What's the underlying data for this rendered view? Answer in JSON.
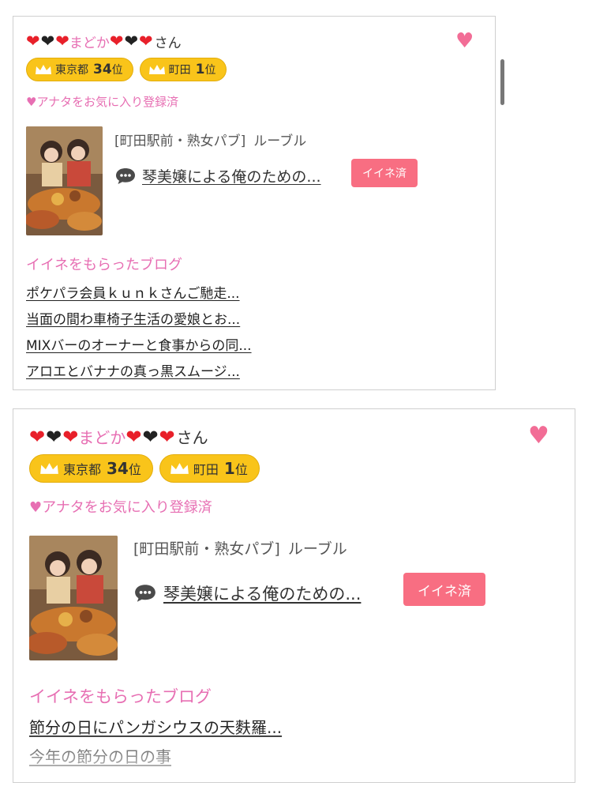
{
  "colors": {
    "accent_pink": "#e76fb3",
    "badge_gold": "#f9c41a",
    "like_button": "#f86e82",
    "favorite_heart": "#f26d96"
  },
  "cards": [
    {
      "name_hearts_before": [
        "red",
        "black",
        "red"
      ],
      "name": "まどか",
      "name_hearts_after": [
        "red",
        "black",
        "red"
      ],
      "suffix": "さん",
      "favorite_icon": "heart-icon",
      "rankings": [
        {
          "icon": "crown-icon",
          "area": "東京都",
          "rank": "34",
          "unit": "位"
        },
        {
          "icon": "crown-icon",
          "area": "町田",
          "rank": "1",
          "unit": "位"
        }
      ],
      "favorite_status": "♥アナタをお気に入り登録済",
      "shop": {
        "tag": "[町田駅前・熟女パブ]",
        "name": "ルーブル"
      },
      "post": {
        "icon": "speech-bubble-icon",
        "title": "琴美嬢による俺のための..."
      },
      "like_button": "イイネ済",
      "blogs_heading": "イイネをもらったブログ",
      "blogs": [
        "ポケパラ会員ｋｕｎｋさんご馳走...",
        "当面の間わ車椅子生活の愛娘とお...",
        "MIXバーのオーナーと食事からの同...",
        "アロエとバナナの真っ黒スムージ..."
      ]
    },
    {
      "name_hearts_before": [
        "red",
        "black",
        "red"
      ],
      "name": "まどか",
      "name_hearts_after": [
        "red",
        "black",
        "red"
      ],
      "suffix": "さん",
      "favorite_icon": "heart-icon",
      "rankings": [
        {
          "icon": "crown-icon",
          "area": "東京都",
          "rank": "34",
          "unit": "位"
        },
        {
          "icon": "crown-icon",
          "area": "町田",
          "rank": "1",
          "unit": "位"
        }
      ],
      "favorite_status": "♥アナタをお気に入り登録済",
      "shop": {
        "tag": "[町田駅前・熟女パブ]",
        "name": "ルーブル"
      },
      "post": {
        "icon": "speech-bubble-icon",
        "title": "琴美嬢による俺のための..."
      },
      "like_button": "イイネ済",
      "blogs_heading": "イイネをもらったブログ",
      "blogs": [
        "節分の日にパンガシウスの天麩羅...",
        "今年の節分の日の事"
      ]
    }
  ]
}
